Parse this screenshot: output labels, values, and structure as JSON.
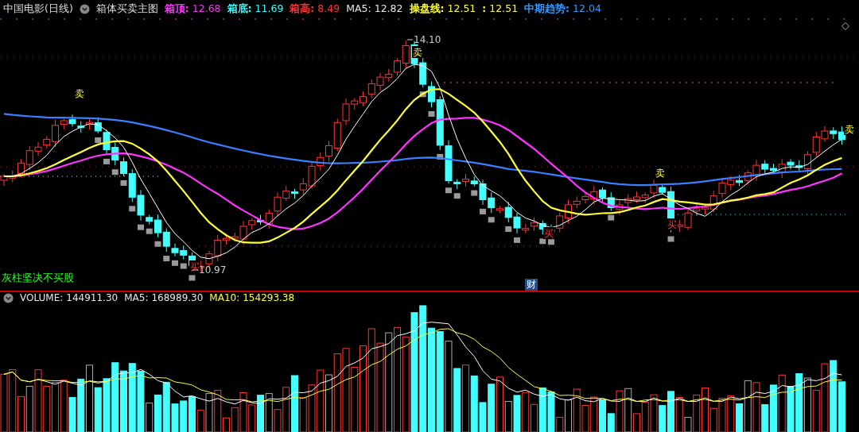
{
  "header": {
    "title": "中国电影(日线)",
    "indicator": "箱体买卖主图",
    "values": [
      {
        "label": "箱顶:",
        "value": "12.68",
        "color": "#ff33ff"
      },
      {
        "label": "箱底:",
        "value": "11.69",
        "color": "#33ffff"
      },
      {
        "label": "箱高:",
        "value": "8.49",
        "color": "#ff3333"
      },
      {
        "label": "MA5:",
        "value": "12.82",
        "color": "#e6e6e6"
      },
      {
        "label": "操盘线:",
        "value": "12.51",
        "color": "#ffff33"
      },
      {
        "label": ":",
        "value": "12.51",
        "color": "#ffff33"
      },
      {
        "label": "中期趋势:",
        "value": "12.04",
        "color": "#3399ff"
      }
    ]
  },
  "chart": {
    "price_labels": [
      {
        "text": "14.10"
      },
      {
        "text": "10.97"
      }
    ],
    "signals": [
      {
        "text": "卖",
        "kind": "sell"
      },
      {
        "text": "卖",
        "kind": "sell"
      },
      {
        "text": "卖",
        "kind": "sell"
      },
      {
        "text": "卖",
        "kind": "sell"
      },
      {
        "text": "买",
        "kind": "buy"
      },
      {
        "text": "买",
        "kind": "buy"
      },
      {
        "text": "买",
        "kind": "buy"
      }
    ],
    "note": "灰柱坚决不买股",
    "finance_badge": "财"
  },
  "volume": {
    "values": [
      {
        "label": "VOLUME:",
        "value": "144911.30",
        "color": "#e6e6e6"
      },
      {
        "label": "MA5:",
        "value": "168989.30",
        "color": "#e6e6e6"
      },
      {
        "label": "MA10:",
        "value": "154293.38",
        "color": "#ffff33"
      }
    ]
  }
}
